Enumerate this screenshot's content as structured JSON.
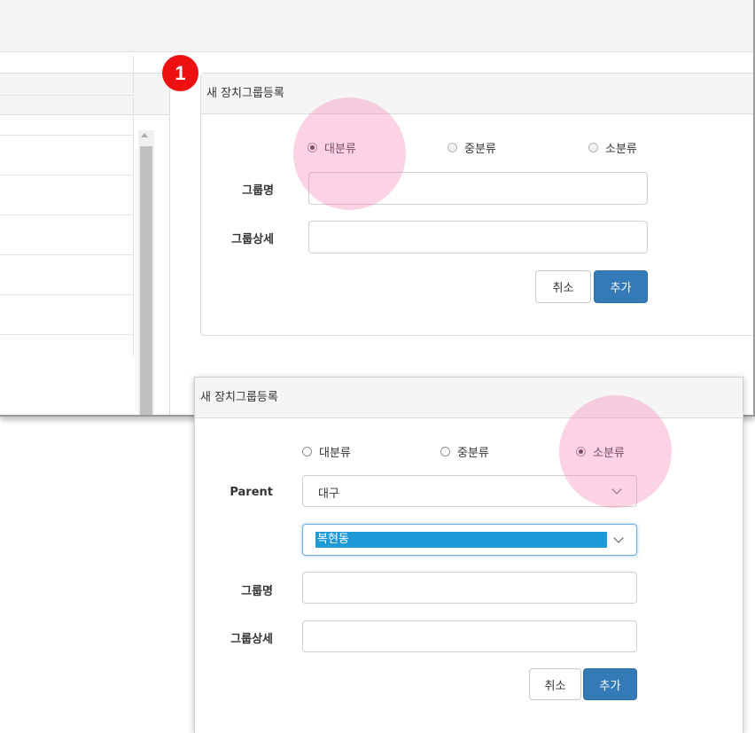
{
  "step_badge": "1",
  "form": {
    "title": "새 장치그룹등록",
    "radios": [
      "대분류",
      "중분류",
      "소분류"
    ],
    "label_name": "그룹명",
    "label_detail": "그룹상세",
    "btn_cancel": "취소",
    "btn_add": "추가"
  },
  "form2": {
    "title": "새 장치그룹등록",
    "radios": [
      "대분류",
      "중분류",
      "소분류"
    ],
    "label_parent": "Parent",
    "parent_value": "대구",
    "sub_parent_value": "복현동",
    "label_name": "그룹명",
    "label_detail": "그룹상세",
    "btn_cancel": "취소",
    "btn_add": "추가"
  },
  "colors": {
    "highlight": "#f782b4",
    "badge": "#ee1111",
    "primary_button": "#337ab7",
    "selection": "#1e9ad9"
  }
}
